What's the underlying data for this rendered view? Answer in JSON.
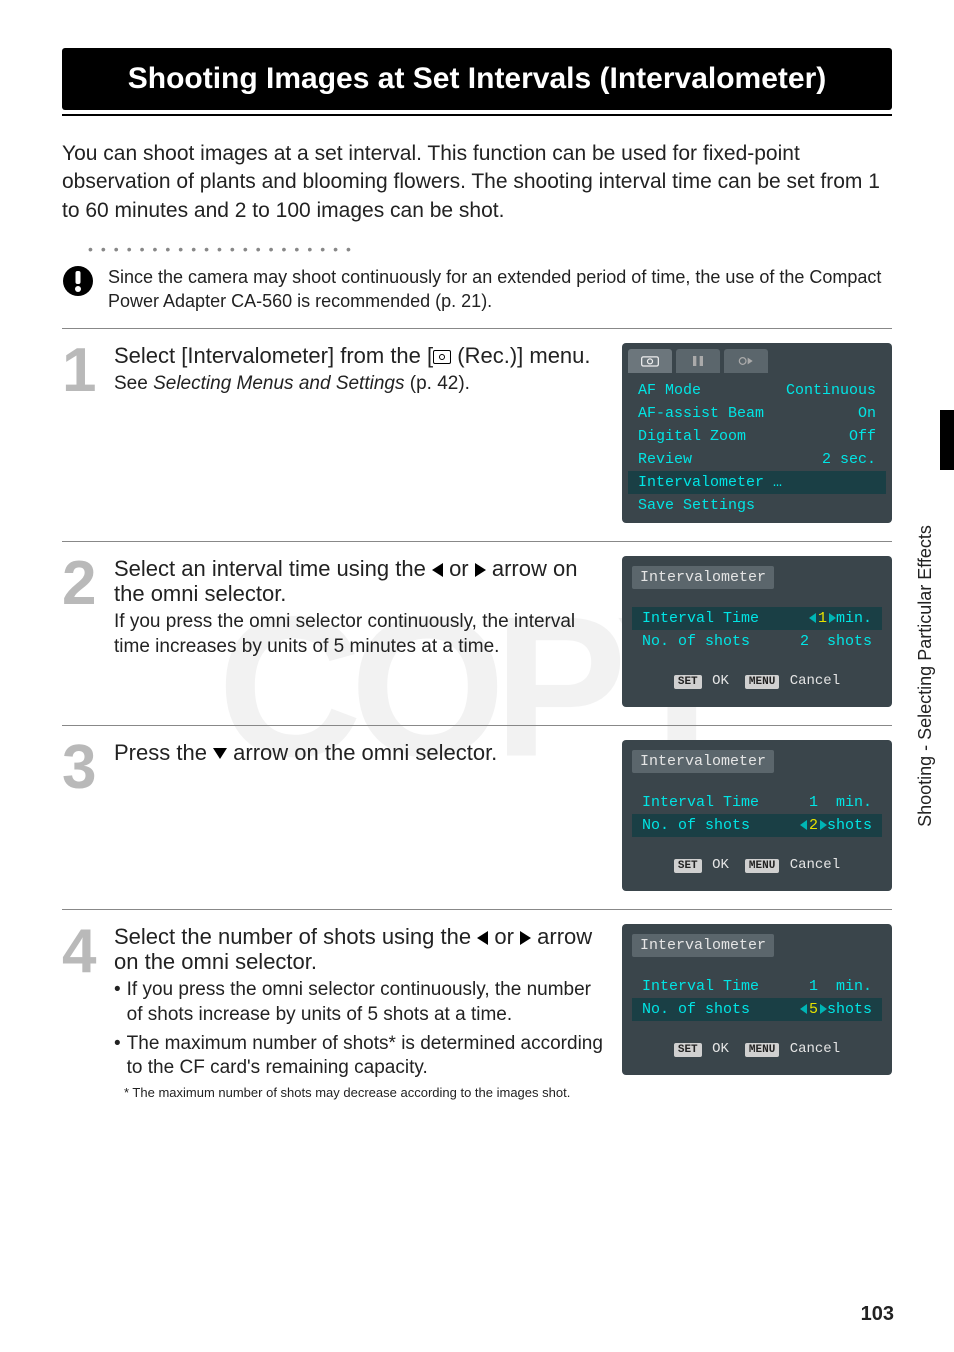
{
  "title": "Shooting Images at Set Intervals (Intervalometer)",
  "intro": "You can shoot images at a set interval. This function can be used for fixed-point observation of plants and blooming flowers. The shooting interval time can be set from 1 to 60 minutes and 2 to 100 images can be shot.",
  "note": "Since the camera may shoot continuously for an extended period of time, the use of the Compact Power Adapter CA-560 is recommended (p. 21).",
  "steps": {
    "s1": {
      "head_a": "Select [Intervalometer] from the [",
      "head_b": " (Rec.)] menu.",
      "text_a": "See ",
      "text_em": "Selecting Menus and Settings",
      "text_b": " (p. 42)."
    },
    "s2": {
      "head_a": "Select an interval time using the ",
      "head_b": " or ",
      "head_c": " arrow on the omni selector.",
      "text": "If you press the omni selector continuously, the interval time increases by units of 5 minutes at a time."
    },
    "s3": {
      "head_a": "Press the ",
      "head_b": " arrow on the omni selector."
    },
    "s4": {
      "head_a": "Select the number of shots using the ",
      "head_b": " or ",
      "head_c": " arrow on the omni selector.",
      "b1": "If you press the omni selector continuously, the number of shots increase by units of 5 shots at a time.",
      "b2": "The maximum number of shots* is determined according to the CF card's remaining capacity.",
      "foot": "* The maximum number of shots may decrease according to the images shot."
    }
  },
  "lcd1": {
    "rows": [
      {
        "label": "AF Mode",
        "value": "Continuous"
      },
      {
        "label": "AF-assist Beam",
        "value": "On"
      },
      {
        "label": "Digital Zoom",
        "value": "Off"
      },
      {
        "label": "Review",
        "value": "2 sec."
      }
    ],
    "hl": "Intervalometer …",
    "last": "Save Settings"
  },
  "lcd_common": {
    "title": "Intervalometer",
    "row1_label": "Interval Time",
    "row2_label": "No. of shots",
    "set": "SET",
    "ok": "OK",
    "menu": "MENU",
    "cancel": "Cancel"
  },
  "lcd2": {
    "time": "1",
    "time_unit": "min.",
    "shots": "2",
    "shots_unit": "shots",
    "active_row": 1
  },
  "lcd3": {
    "time": "1",
    "time_unit": "min.",
    "shots": "2",
    "shots_unit": "shots",
    "active_row": 2
  },
  "lcd4": {
    "time": "1",
    "time_unit": "min.",
    "shots": "5",
    "shots_unit": "shots",
    "active_row": 2
  },
  "side_label": "Shooting - Selecting Particular Effects",
  "page_number": "103"
}
